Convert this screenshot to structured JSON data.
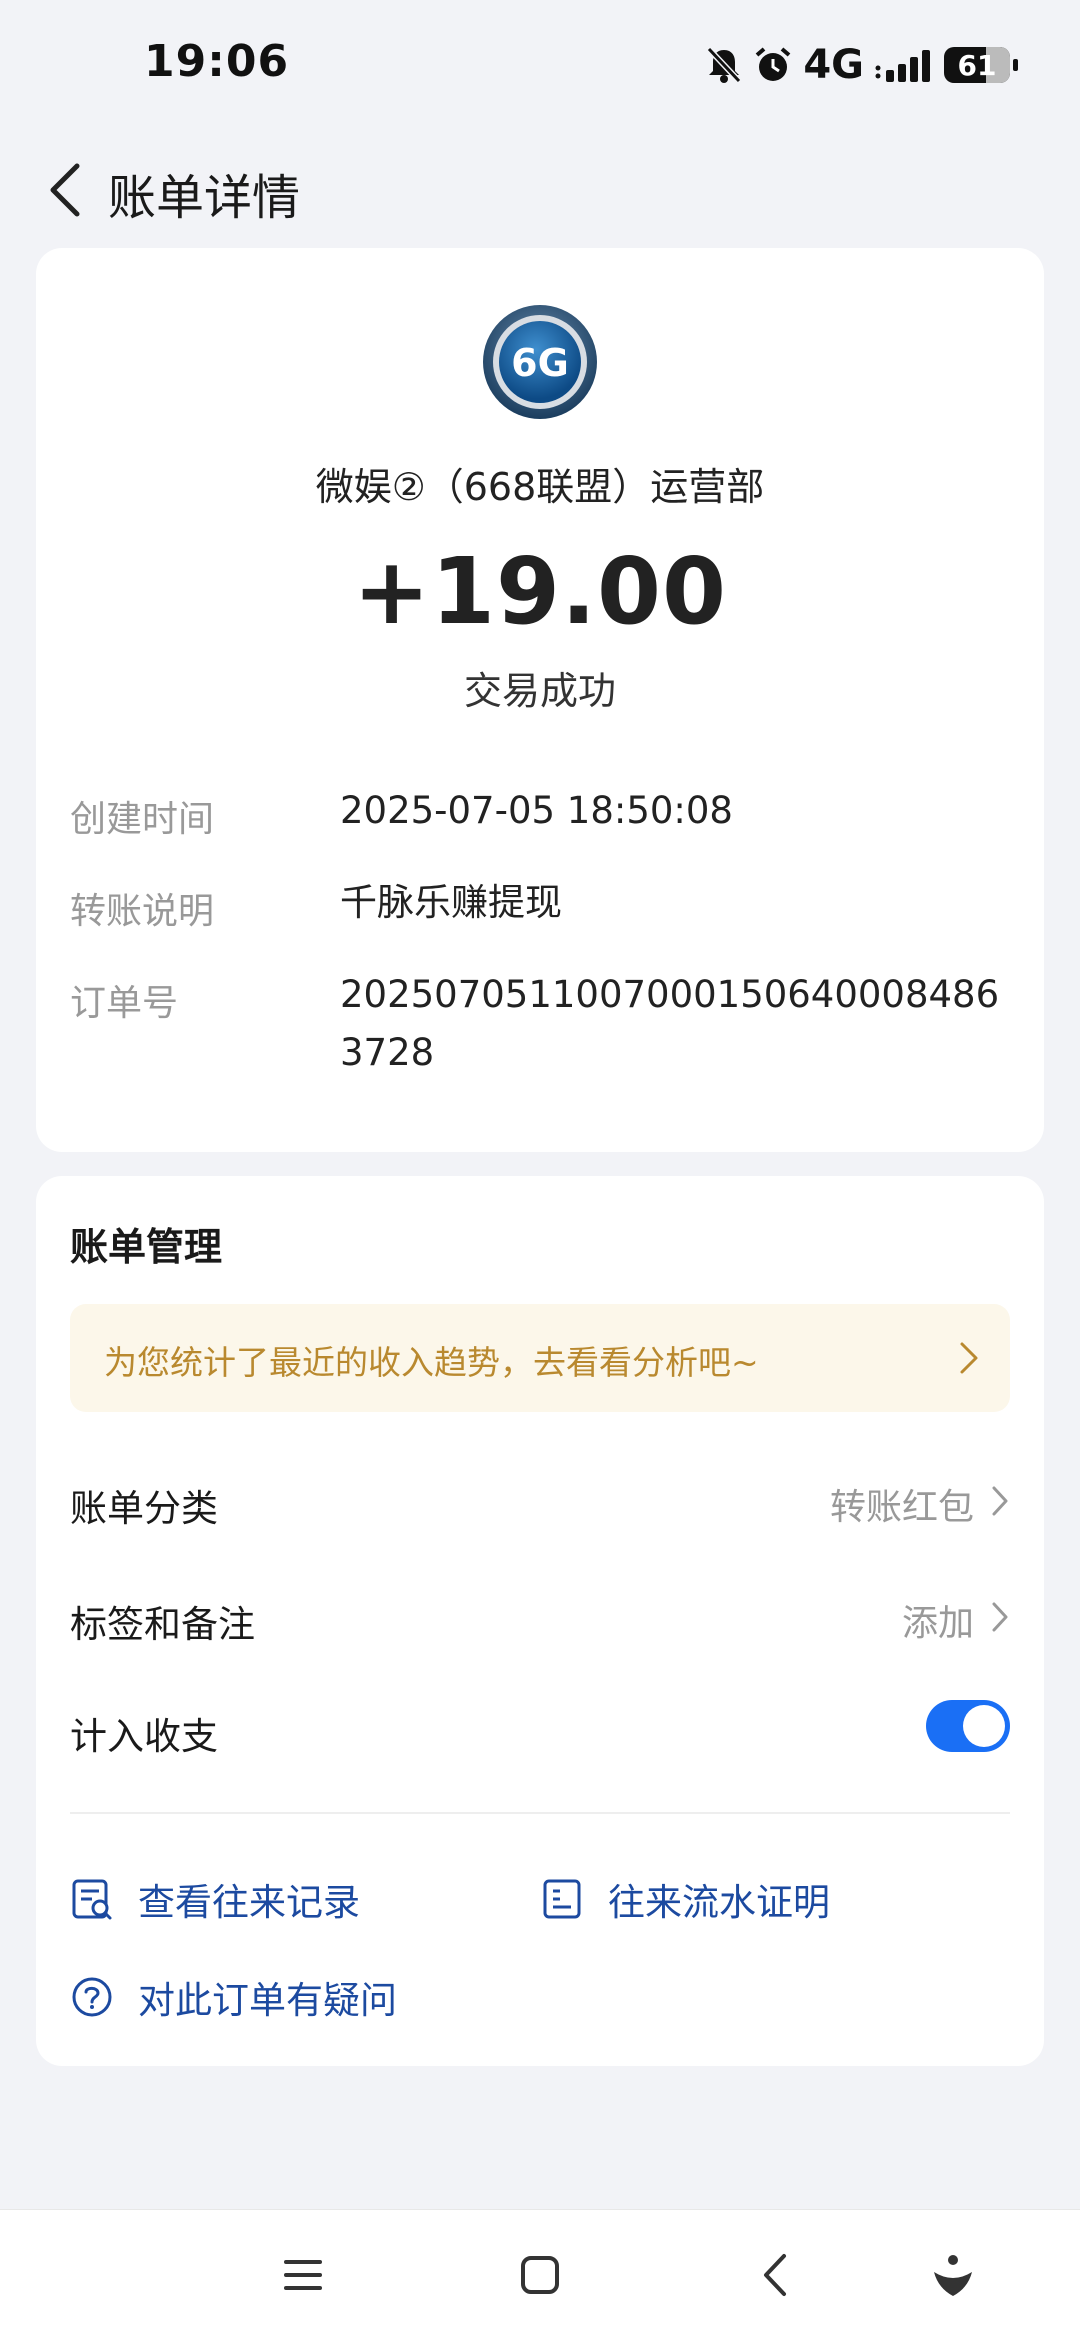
{
  "status_bar": {
    "time": "19:06",
    "network": "4G",
    "battery": "61",
    "icons": [
      "mute-bell-icon",
      "alarm-icon",
      "signal-icon",
      "battery-icon"
    ]
  },
  "header": {
    "title": "账单详情",
    "back_icon": "back-chevron-icon"
  },
  "transaction": {
    "avatar_text": "6G",
    "merchant": "微娱②（668联盟）运营部",
    "amount": "+19.00",
    "status": "交易成功",
    "details": [
      {
        "label": "创建时间",
        "value": "2025-07-05 18:50:08"
      },
      {
        "label": "转账说明",
        "value": "千脉乐赚提现"
      },
      {
        "label": "订单号",
        "value": "2025070511007000150640008486 3728"
      }
    ]
  },
  "management": {
    "title": "账单管理",
    "banner_text": "为您统计了最近的收入趋势，去看看分析吧~",
    "category_label": "账单分类",
    "category_value": "转账红包",
    "tags_label": "标签和备注",
    "tags_value": "添加",
    "include_label": "计入收支",
    "include_enabled": true,
    "actions": {
      "records": "查看往来记录",
      "proof": "往来流水证明",
      "question": "对此订单有疑问"
    }
  },
  "colors": {
    "accent": "#1a6ff5",
    "link": "#1c4aa0",
    "banner_bg": "#fcf7ea",
    "banner_text": "#b9892f",
    "page_bg": "#f2f3f7"
  }
}
